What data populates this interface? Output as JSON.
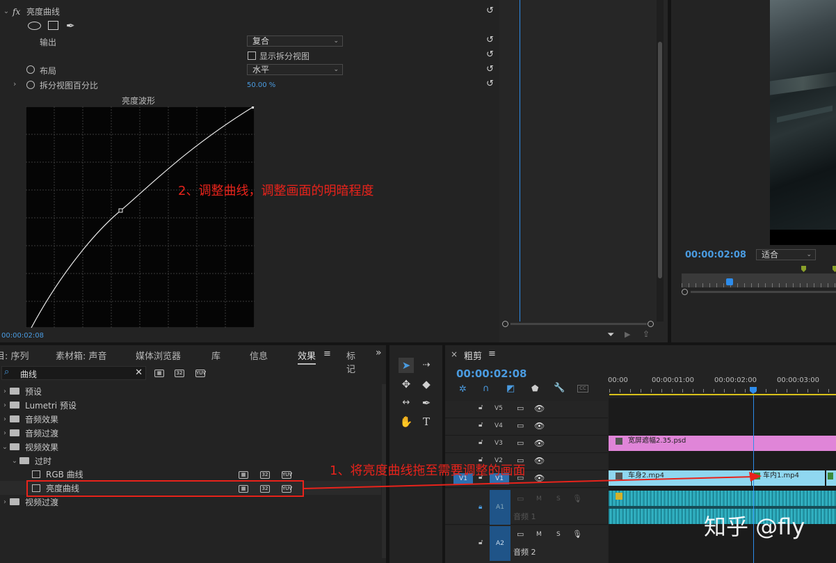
{
  "effect_controls": {
    "fx_label": "fx",
    "effect_name": "亮度曲线",
    "output_label": "输出",
    "output_value": "复合",
    "split_view_label": "显示拆分视图",
    "layout_label": "布局",
    "layout_value": "水平",
    "split_percent_label": "拆分视图百分比",
    "split_percent_value": "50.00 %",
    "waveform_title": "亮度波形",
    "timecode": "00:00:02:08"
  },
  "annotations": {
    "step2": "2、调整曲线，调整画面的明暗程度",
    "step1": "1、将亮度曲线拖至需要调整的画面"
  },
  "program_monitor": {
    "timecode": "00:00:02:08",
    "fit_value": "适合"
  },
  "effects_panel": {
    "tabs": [
      "目: 序列",
      "素材箱: 声音",
      "媒体浏览器",
      "库",
      "信息",
      "效果",
      "标记"
    ],
    "active_tab": "效果",
    "search_value": "曲线",
    "badges": [
      "32",
      "YUV"
    ],
    "tree": [
      {
        "label": "预设",
        "indent": 0,
        "expanded": false
      },
      {
        "label": "Lumetri 预设",
        "indent": 0,
        "expanded": false
      },
      {
        "label": "音频效果",
        "indent": 0,
        "expanded": false
      },
      {
        "label": "音频过渡",
        "indent": 0,
        "expanded": false
      },
      {
        "label": "视频效果",
        "indent": 0,
        "expanded": true
      },
      {
        "label": "过时",
        "indent": 1,
        "expanded": true
      },
      {
        "label": "RGB 曲线",
        "indent": 2,
        "item": true
      },
      {
        "label": "亮度曲线",
        "indent": 2,
        "item": true,
        "selected": true
      },
      {
        "label": "视频过渡",
        "indent": 0,
        "expanded": false
      }
    ]
  },
  "timeline": {
    "close": "×",
    "title": "粗剪",
    "timecode": "00:00:02:08",
    "ruler": [
      "00:00",
      "00:00:01:00",
      "00:00:02:00",
      "00:00:03:00"
    ],
    "tracks": [
      {
        "name": "V5"
      },
      {
        "name": "V4"
      },
      {
        "name": "V3"
      },
      {
        "name": "V2"
      },
      {
        "name": "V1",
        "source": "V1"
      }
    ],
    "audio_tracks": [
      {
        "name": "A1",
        "label": "音频 1"
      },
      {
        "name": "A2",
        "label": "音频 2"
      }
    ],
    "audio_buttons": [
      "M",
      "S"
    ],
    "clips": {
      "v3": "宽屏遮幅2.35.psd",
      "v1a": "车身2.mp4",
      "v1b": "车内1.mp4"
    },
    "accent": "#2d8ceb"
  },
  "watermark": "知乎 @fly"
}
